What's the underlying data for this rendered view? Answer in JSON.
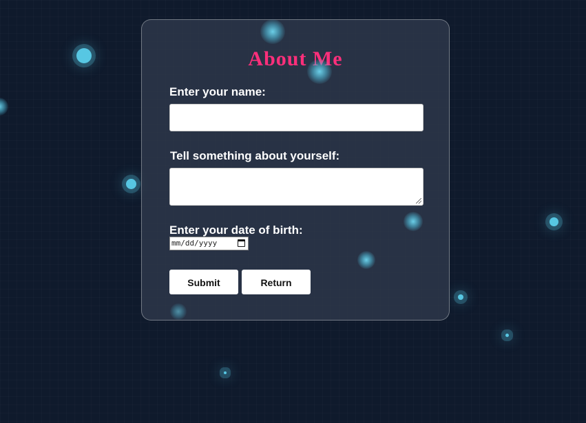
{
  "form": {
    "title": "About Me",
    "name_label": "Enter your name:",
    "name_value": "",
    "about_label": "Tell something about yourself:",
    "about_value": "",
    "dob_label": "Enter your date of birth:",
    "dob_placeholder": "mm/dd/yyyy",
    "submit_label": "Submit",
    "return_label": "Return"
  },
  "colors": {
    "background": "#0f1a2c",
    "title": "#ff2f7b",
    "glow": "#57c7e3"
  }
}
